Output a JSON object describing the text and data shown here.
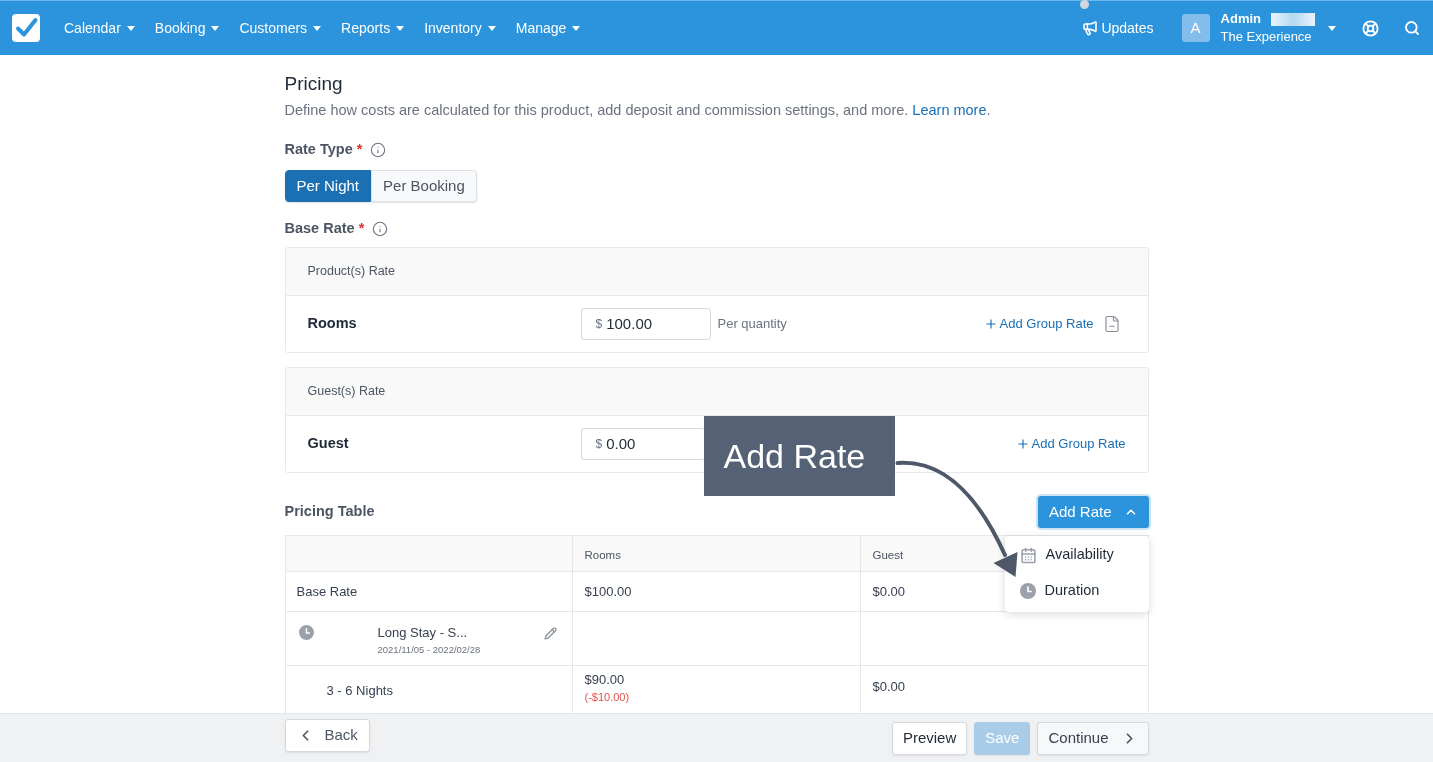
{
  "nav": {
    "items": [
      {
        "label": "Calendar"
      },
      {
        "label": "Booking"
      },
      {
        "label": "Customers"
      },
      {
        "label": "Reports"
      },
      {
        "label": "Inventory"
      },
      {
        "label": "Manage"
      }
    ],
    "updates": {
      "label": "Updates",
      "unread": true
    },
    "account": {
      "initial": "A",
      "name": "Admin",
      "organization": "The Experience"
    }
  },
  "header": {
    "title": "Pricing",
    "description": "Define how costs are calculated for this product, add deposit and commission settings, and more.",
    "link": "Learn more",
    "description_end": "."
  },
  "rate_type": {
    "label": "Rate Type",
    "required_mark": "*",
    "options": [
      {
        "label": "Per Night",
        "selected": true
      },
      {
        "label": "Per Booking",
        "selected": false
      }
    ]
  },
  "base_rate": {
    "label": "Base Rate",
    "required_mark": "*",
    "cards": [
      {
        "heading": "Product(s) Rate",
        "name": "Rooms",
        "currency": "$",
        "value": "100.00",
        "unit": "Per quantity",
        "action": "Add Group Rate",
        "has_document": true
      },
      {
        "heading": "Guest(s) Rate",
        "name": "Guest",
        "currency": "$",
        "value": "0.00",
        "action": "Add Group Rate",
        "has_document": false
      }
    ]
  },
  "annotation": {
    "text": "Add Rate"
  },
  "pricing_table": {
    "title": "Pricing Table",
    "add_button": {
      "label": "Add Rate",
      "expanded": true
    },
    "menu": [
      {
        "kind": "availability",
        "label": "Availability"
      },
      {
        "kind": "duration",
        "label": "Duration"
      }
    ],
    "columns": [
      "Rooms",
      "Guest"
    ],
    "rows": [
      {
        "kind": "base",
        "label": "Base Rate",
        "cells": [
          {
            "value": "$100.00"
          },
          {
            "value": "$0.00"
          }
        ]
      },
      {
        "kind": "period",
        "label": "Long Stay - S...",
        "dates": "2021/11/05 - 2022/02/28",
        "editable": true
      },
      {
        "kind": "tier",
        "label": "3 - 6 Nights",
        "cells": [
          {
            "value": "$90.00",
            "change": "(-$10.00)"
          },
          {
            "value": "$0.00"
          }
        ]
      }
    ]
  },
  "footer": {
    "back": "Back",
    "buttons": [
      {
        "kind": "plain",
        "label": "Preview",
        "disabled": false
      },
      {
        "kind": "primary",
        "label": "Save",
        "disabled": true
      },
      {
        "kind": "next",
        "label": "Continue",
        "disabled": false
      }
    ]
  }
}
